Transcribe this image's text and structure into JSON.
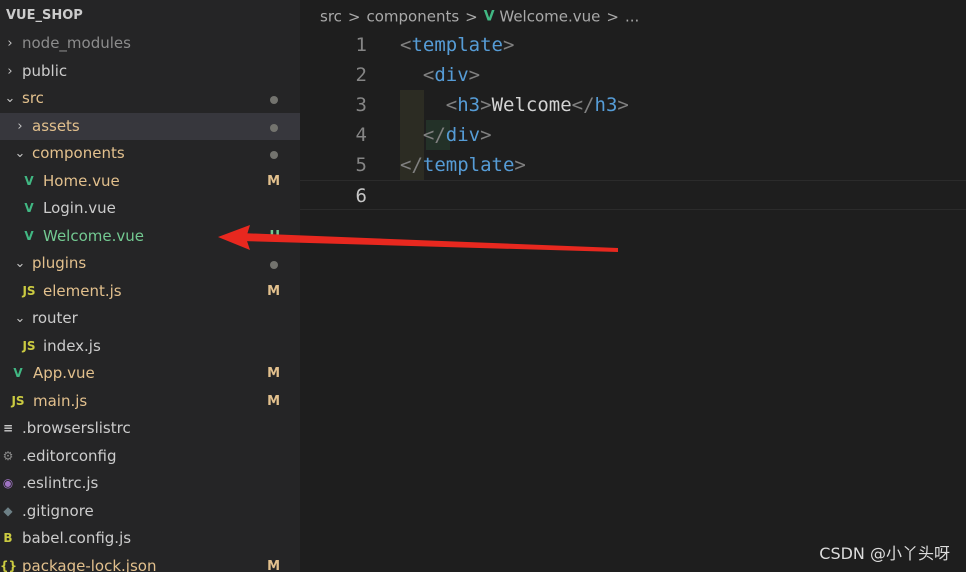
{
  "sidebar": {
    "title": "VUE_SHOP",
    "items": [
      {
        "label": "node_modules",
        "chev": "›",
        "icon": "",
        "icon_name": "chevron-right-icon",
        "color": "dim",
        "status": ""
      },
      {
        "label": "public",
        "chev": "›",
        "icon": "",
        "icon_name": "chevron-right-icon",
        "color": "def",
        "status": ""
      },
      {
        "label": "src",
        "chev": "⌄",
        "icon": "",
        "icon_name": "chevron-down-icon",
        "color": "mod",
        "status": "dot"
      },
      {
        "label": "assets",
        "chev": "›",
        "icon": "",
        "icon_name": "chevron-right-icon",
        "color": "mod",
        "status": "dot",
        "selected": true
      },
      {
        "label": "components",
        "chev": "⌄",
        "icon": "",
        "icon_name": "chevron-down-icon",
        "color": "mod",
        "status": "dot"
      },
      {
        "label": "Home.vue",
        "chev": "",
        "icon": "V",
        "icon_name": "vue-file-icon",
        "color": "mod",
        "status": "M"
      },
      {
        "label": "Login.vue",
        "chev": "",
        "icon": "V",
        "icon_name": "vue-file-icon",
        "color": "def",
        "status": ""
      },
      {
        "label": "Welcome.vue",
        "chev": "",
        "icon": "V",
        "icon_name": "vue-file-icon",
        "color": "untracked",
        "status": "U"
      },
      {
        "label": "plugins",
        "chev": "⌄",
        "icon": "",
        "icon_name": "chevron-down-icon",
        "color": "mod",
        "status": "dot"
      },
      {
        "label": "element.js",
        "chev": "",
        "icon": "JS",
        "icon_name": "js-file-icon",
        "color": "mod",
        "status": "M"
      },
      {
        "label": "router",
        "chev": "⌄",
        "icon": "",
        "icon_name": "chevron-down-icon",
        "color": "def",
        "status": ""
      },
      {
        "label": "index.js",
        "chev": "",
        "icon": "JS",
        "icon_name": "js-file-icon",
        "color": "def",
        "status": ""
      },
      {
        "label": "App.vue",
        "chev": "",
        "icon": "V",
        "icon_name": "vue-file-icon",
        "color": "mod",
        "status": "M"
      },
      {
        "label": "main.js",
        "chev": "",
        "icon": "JS",
        "icon_name": "js-file-icon",
        "color": "mod",
        "status": "M"
      },
      {
        "label": ".browserslistrc",
        "chev": "",
        "icon": "≡",
        "icon_name": "list-file-icon",
        "color": "def",
        "status": ""
      },
      {
        "label": ".editorconfig",
        "chev": "",
        "icon": "⚙",
        "icon_name": "gear-file-icon",
        "color": "def",
        "status": ""
      },
      {
        "label": ".eslintrc.js",
        "chev": "",
        "icon": "◉",
        "icon_name": "eslint-file-icon",
        "color": "def",
        "status": ""
      },
      {
        "label": ".gitignore",
        "chev": "",
        "icon": "◆",
        "icon_name": "git-file-icon",
        "color": "def",
        "status": ""
      },
      {
        "label": "babel.config.js",
        "chev": "",
        "icon": "B",
        "icon_name": "babel-file-icon",
        "color": "def",
        "status": ""
      },
      {
        "label": "package-lock.json",
        "chev": "",
        "icon": "{}",
        "icon_name": "json-file-icon",
        "color": "mod",
        "status": "M"
      }
    ]
  },
  "breadcrumb": {
    "parts": [
      "src",
      "components",
      "Welcome.vue",
      "..."
    ],
    "separator": ">"
  },
  "editor": {
    "line_numbers": [
      "1",
      "2",
      "3",
      "4",
      "5",
      "6"
    ],
    "active_line": "6",
    "lines": [
      {
        "indent": "",
        "open": "<",
        "tag": "template",
        "close": ">",
        "text": "",
        "end": ""
      },
      {
        "indent": "  ",
        "open": "<",
        "tag": "div",
        "close": ">",
        "text": "",
        "end": ""
      },
      {
        "indent": "    ",
        "open": "<",
        "tag": "h3",
        "close": ">",
        "text": "Welcome",
        "end": "h3"
      },
      {
        "indent": "  ",
        "open": "</",
        "tag": "div",
        "close": ">",
        "text": "",
        "end": ""
      },
      {
        "indent": "",
        "open": "</",
        "tag": "template",
        "close": ">",
        "text": "",
        "end": ""
      },
      {
        "indent": "",
        "open": "",
        "tag": "",
        "close": "",
        "text": "",
        "end": ""
      }
    ]
  },
  "watermark": "CSDN @小丫头呀",
  "colors": {
    "modified": "#e2c08d",
    "untracked": "#73c991",
    "vue_icon": "#41b883",
    "js_icon": "#cbcb41",
    "arrow": "#e8281f"
  }
}
